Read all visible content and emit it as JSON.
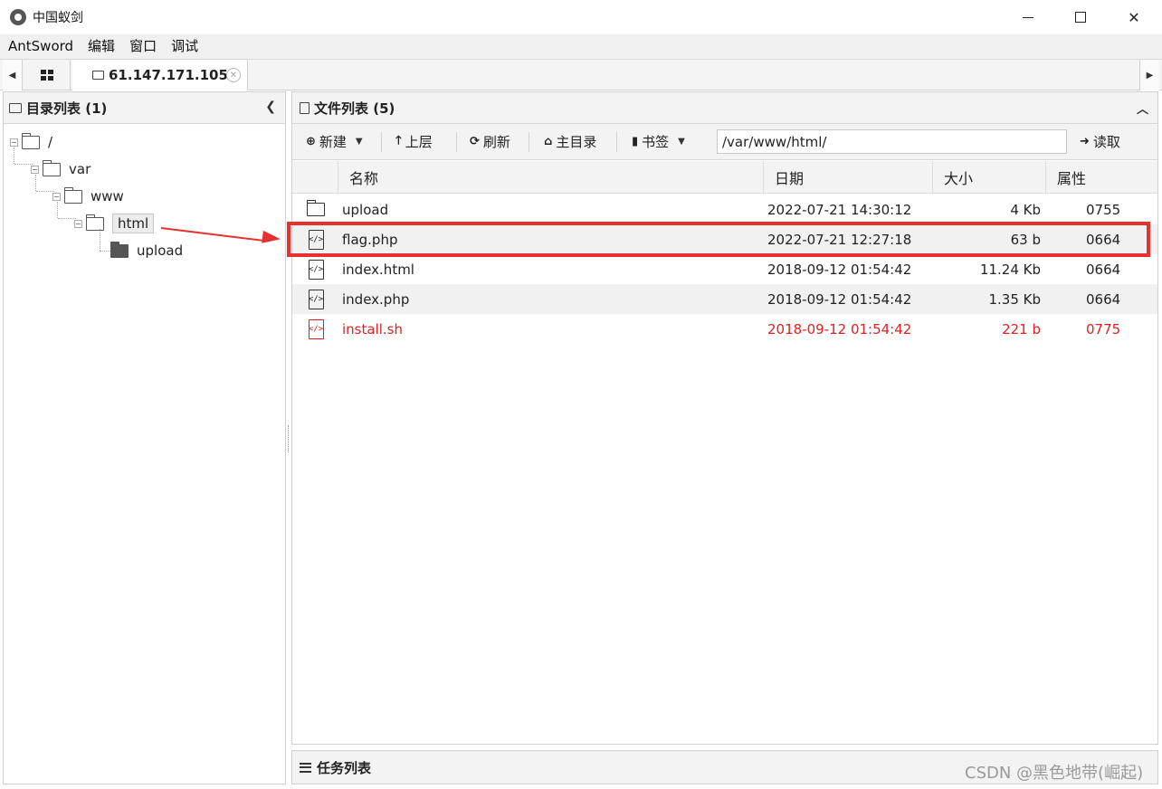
{
  "window": {
    "title": "中国蚁剑"
  },
  "menu": [
    "AntSword",
    "编辑",
    "窗口",
    "调试"
  ],
  "tabs": {
    "host": "61.147.171.105"
  },
  "left_panel": {
    "title": "目录列表 (1)",
    "tree": [
      {
        "label": "/",
        "level": 0
      },
      {
        "label": "var",
        "level": 1
      },
      {
        "label": "www",
        "level": 2
      },
      {
        "label": "html",
        "level": 3,
        "selected": true
      },
      {
        "label": "upload",
        "level": 4
      }
    ]
  },
  "right_panel": {
    "title": "文件列表 (5)",
    "toolbar": {
      "new": "新建",
      "up": "上层",
      "refresh": "刷新",
      "home": "主目录",
      "bookmark": "书签",
      "path": "/var/www/html/",
      "read": "读取"
    },
    "columns": [
      "名称",
      "日期",
      "大小",
      "属性"
    ],
    "files": [
      {
        "name": "upload",
        "date": "2022-07-21 14:30:12",
        "size": "4 Kb",
        "attr": "0755",
        "type": "folder",
        "danger": false
      },
      {
        "name": "flag.php",
        "date": "2022-07-21 12:27:18",
        "size": "63 b",
        "attr": "0664",
        "type": "code",
        "danger": false
      },
      {
        "name": "index.html",
        "date": "2018-09-12 01:54:42",
        "size": "11.24 Kb",
        "attr": "0664",
        "type": "code",
        "danger": false
      },
      {
        "name": "index.php",
        "date": "2018-09-12 01:54:42",
        "size": "1.35 Kb",
        "attr": "0664",
        "type": "code",
        "danger": false
      },
      {
        "name": "install.sh",
        "date": "2018-09-12 01:54:42",
        "size": "221 b",
        "attr": "0775",
        "type": "code",
        "danger": true
      }
    ]
  },
  "task_panel": {
    "title": "任务列表"
  },
  "watermark": "CSDN @黑色地带(崛起)",
  "colors": {
    "danger": "#e02020",
    "highlight": "#e8312f"
  }
}
